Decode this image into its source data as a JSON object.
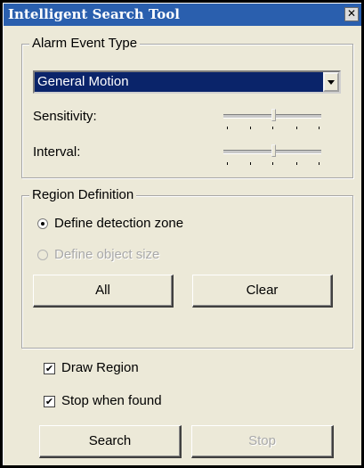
{
  "window": {
    "title": "Intelligent Search Tool",
    "close_glyph": "✕"
  },
  "alarm": {
    "legend": "Alarm Event Type",
    "selected": "General Motion",
    "sensitivity_label": "Sensitivity:",
    "sensitivity_level": 0.5,
    "interval_label": "Interval:",
    "interval_level": 0.5
  },
  "region": {
    "legend": "Region Definition",
    "option_zone": "Define detection zone",
    "option_object": "Define object size",
    "all_label": "All",
    "clear_label": "Clear"
  },
  "options": {
    "draw_region_label": "Draw Region",
    "stop_found_label": "Stop when found",
    "check_glyph": "✔"
  },
  "actions": {
    "search_label": "Search",
    "stop_label": "Stop"
  }
}
